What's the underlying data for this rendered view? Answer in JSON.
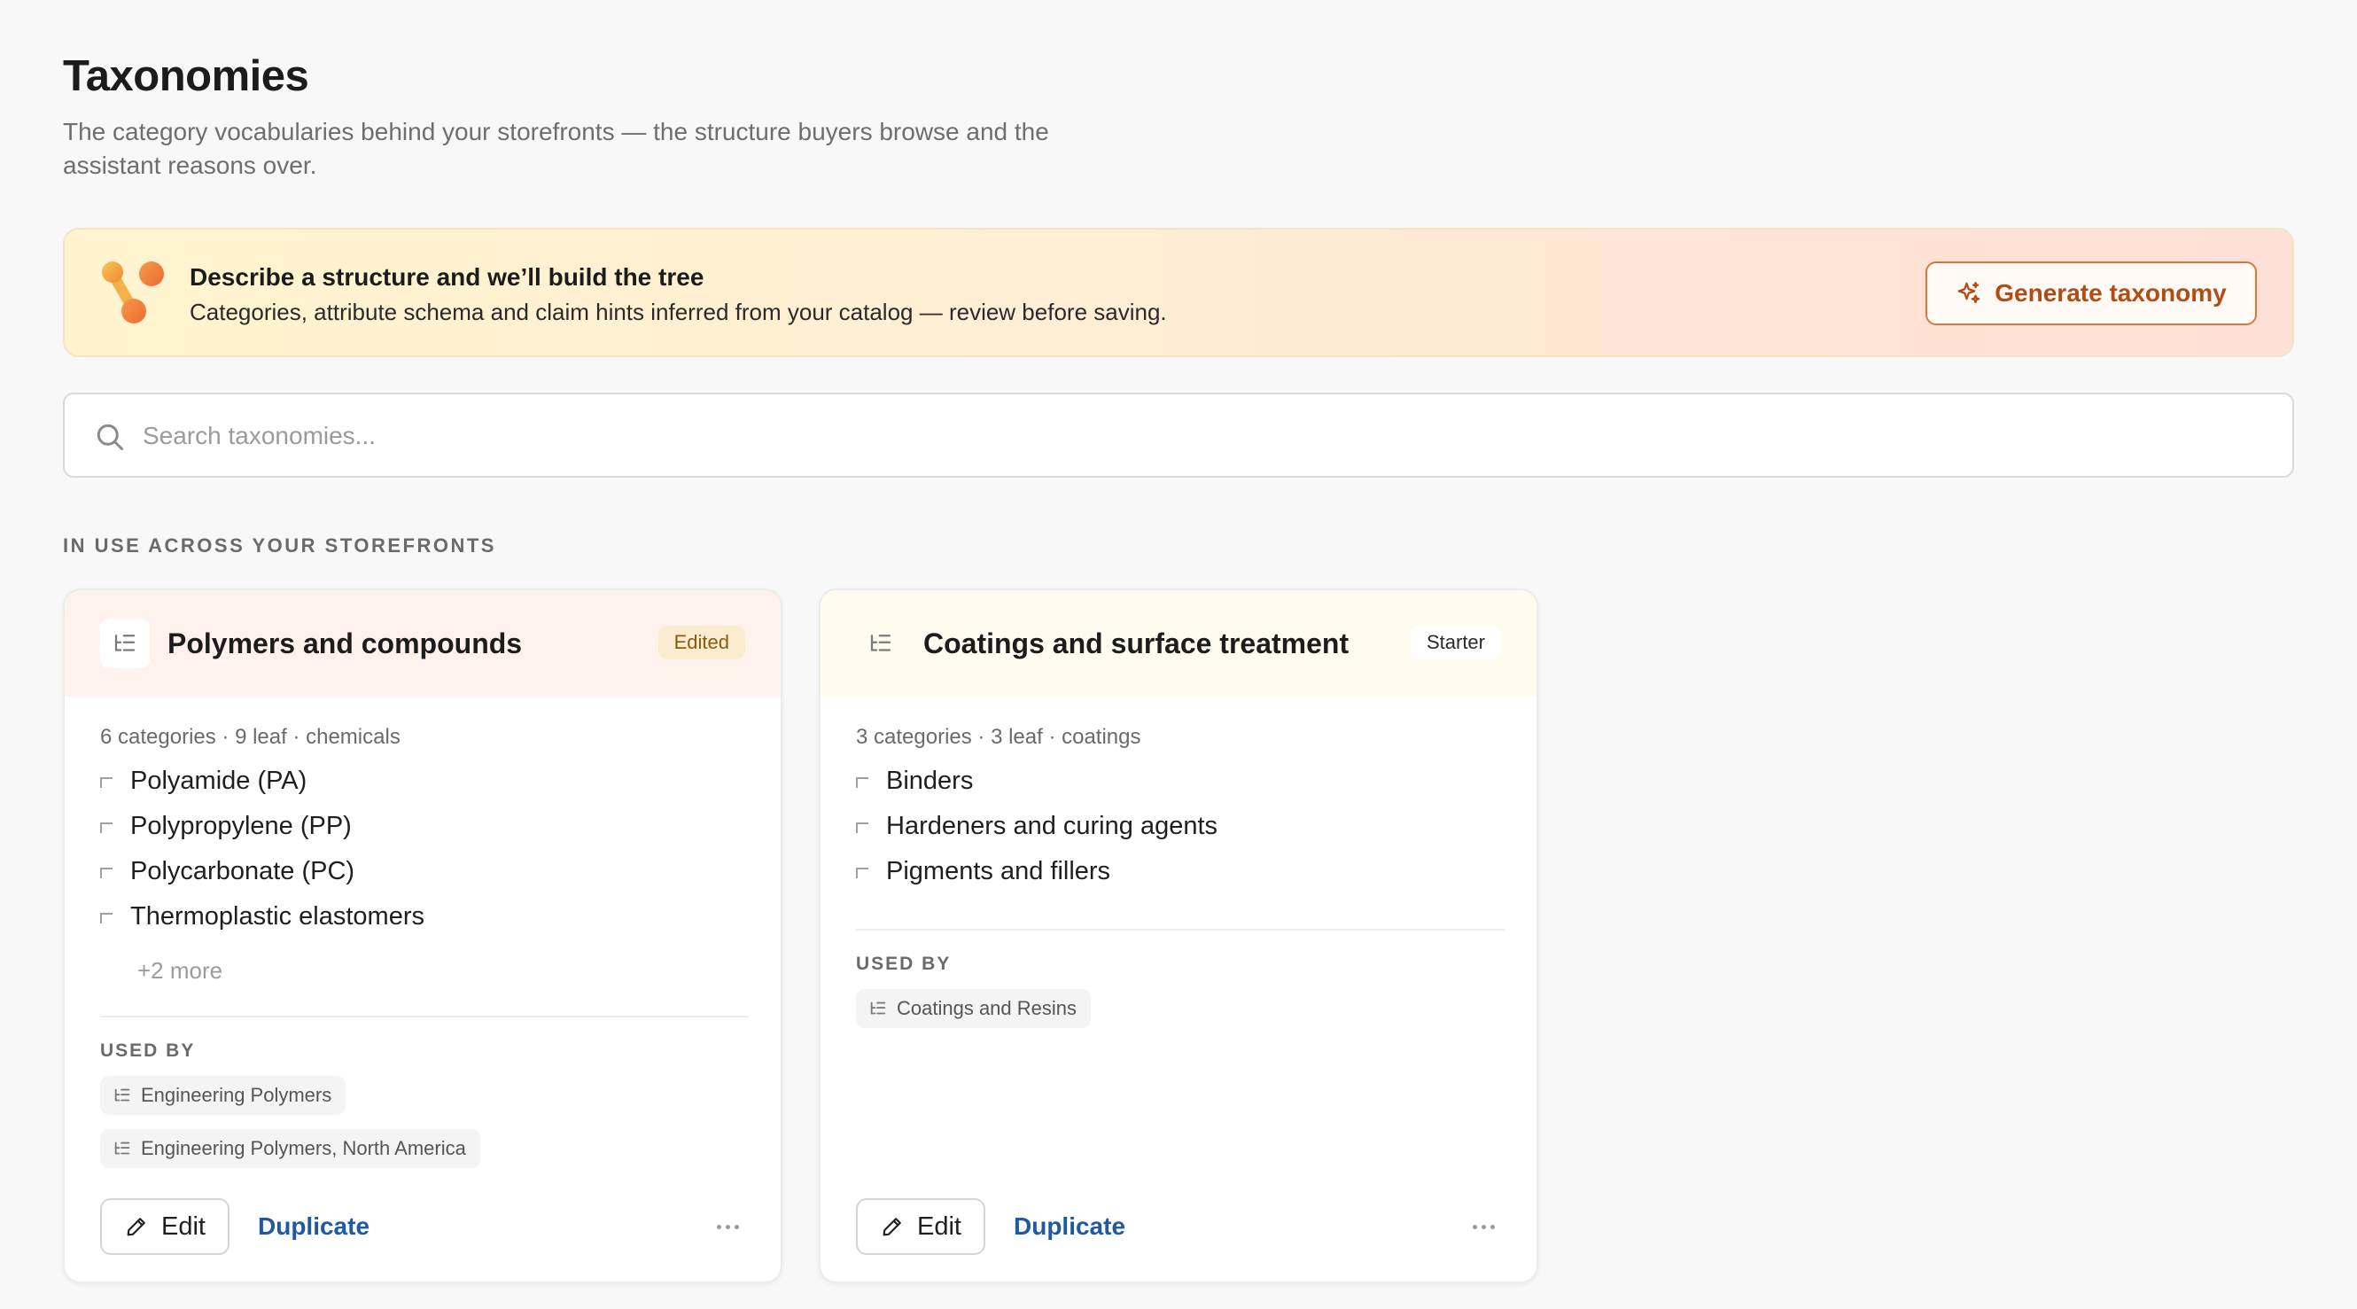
{
  "page": {
    "title": "Taxonomies",
    "subtitle": "The category vocabularies behind your storefronts — the structure buyers browse and the assistant reasons over."
  },
  "banner": {
    "heading": "Describe a structure and we’ll build the tree",
    "description": "Categories, attribute schema and claim hints inferred from your catalog — review before saving.",
    "button_label": "Generate taxonomy",
    "accent_color": "#d9763a"
  },
  "search": {
    "placeholder": "Search taxonomies..."
  },
  "section": {
    "label": "IN USE ACROSS YOUR STOREFRONTS"
  },
  "cards": [
    {
      "title": "Polymers and compounds",
      "badge": "Edited",
      "meta": "6 categories · 9 leaf · chemicals",
      "categories": [
        "Polyamide (PA)",
        "Polypropylene (PP)",
        "Polycarbonate (PC)",
        "Thermoplastic elastomers"
      ],
      "more": "+2 more",
      "used_by_label": "USED BY",
      "used_by": [
        "Engineering Polymers",
        "Engineering Polymers, North America"
      ],
      "edit_label": "Edit",
      "duplicate_label": "Duplicate"
    },
    {
      "title": "Coatings and surface treatment",
      "badge": "Starter",
      "meta": "3 categories · 3 leaf · coatings",
      "categories": [
        "Binders",
        "Hardeners and curing agents",
        "Pigments and fillers"
      ],
      "used_by_label": "USED BY",
      "used_by": [
        "Coatings and Resins"
      ],
      "edit_label": "Edit",
      "duplicate_label": "Duplicate"
    }
  ]
}
